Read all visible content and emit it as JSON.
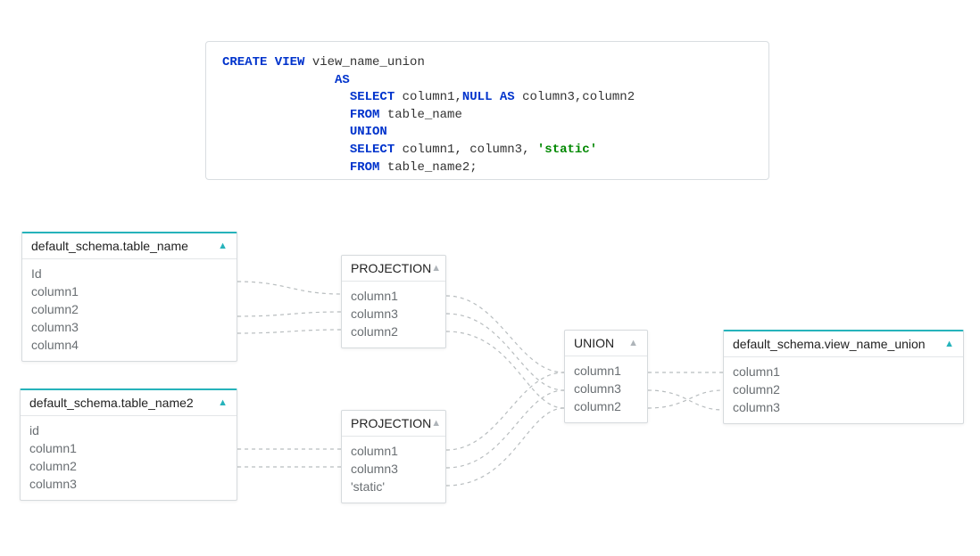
{
  "sql": {
    "l1_kw": "CREATE VIEW",
    "l1_rest": " view_name_union",
    "l2_kw": "AS",
    "l3_kw": "SELECT",
    "l3_mid": " column1,",
    "l3_kw2": "NULL AS",
    "l3_rest": " column3,column2",
    "l4_kw": "FROM",
    "l4_rest": " table_name",
    "l5_kw": "UNION",
    "l6_kw": "SELECT",
    "l6_mid": " column1, column3, ",
    "l6_str": "'static'",
    "l7_kw": "FROM",
    "l7_rest": " table_name2;"
  },
  "nodes": {
    "table1": {
      "title": "default_schema.table_name",
      "rows": [
        "Id",
        "column1",
        "column2",
        "column3",
        "column4"
      ]
    },
    "table2": {
      "title": "default_schema.table_name2",
      "rows": [
        "id",
        "column1",
        "column2",
        "column3"
      ]
    },
    "proj1": {
      "title": "PROJECTION",
      "rows": [
        "column1",
        "column3",
        "column2"
      ]
    },
    "proj2": {
      "title": "PROJECTION",
      "rows": [
        "column1",
        "column3",
        "'static'"
      ]
    },
    "union": {
      "title": "UNION",
      "rows": [
        "column1",
        "column3",
        "column2"
      ]
    },
    "view": {
      "title": "default_schema.view_name_union",
      "rows": [
        "column1",
        "column2",
        "column3"
      ]
    }
  }
}
